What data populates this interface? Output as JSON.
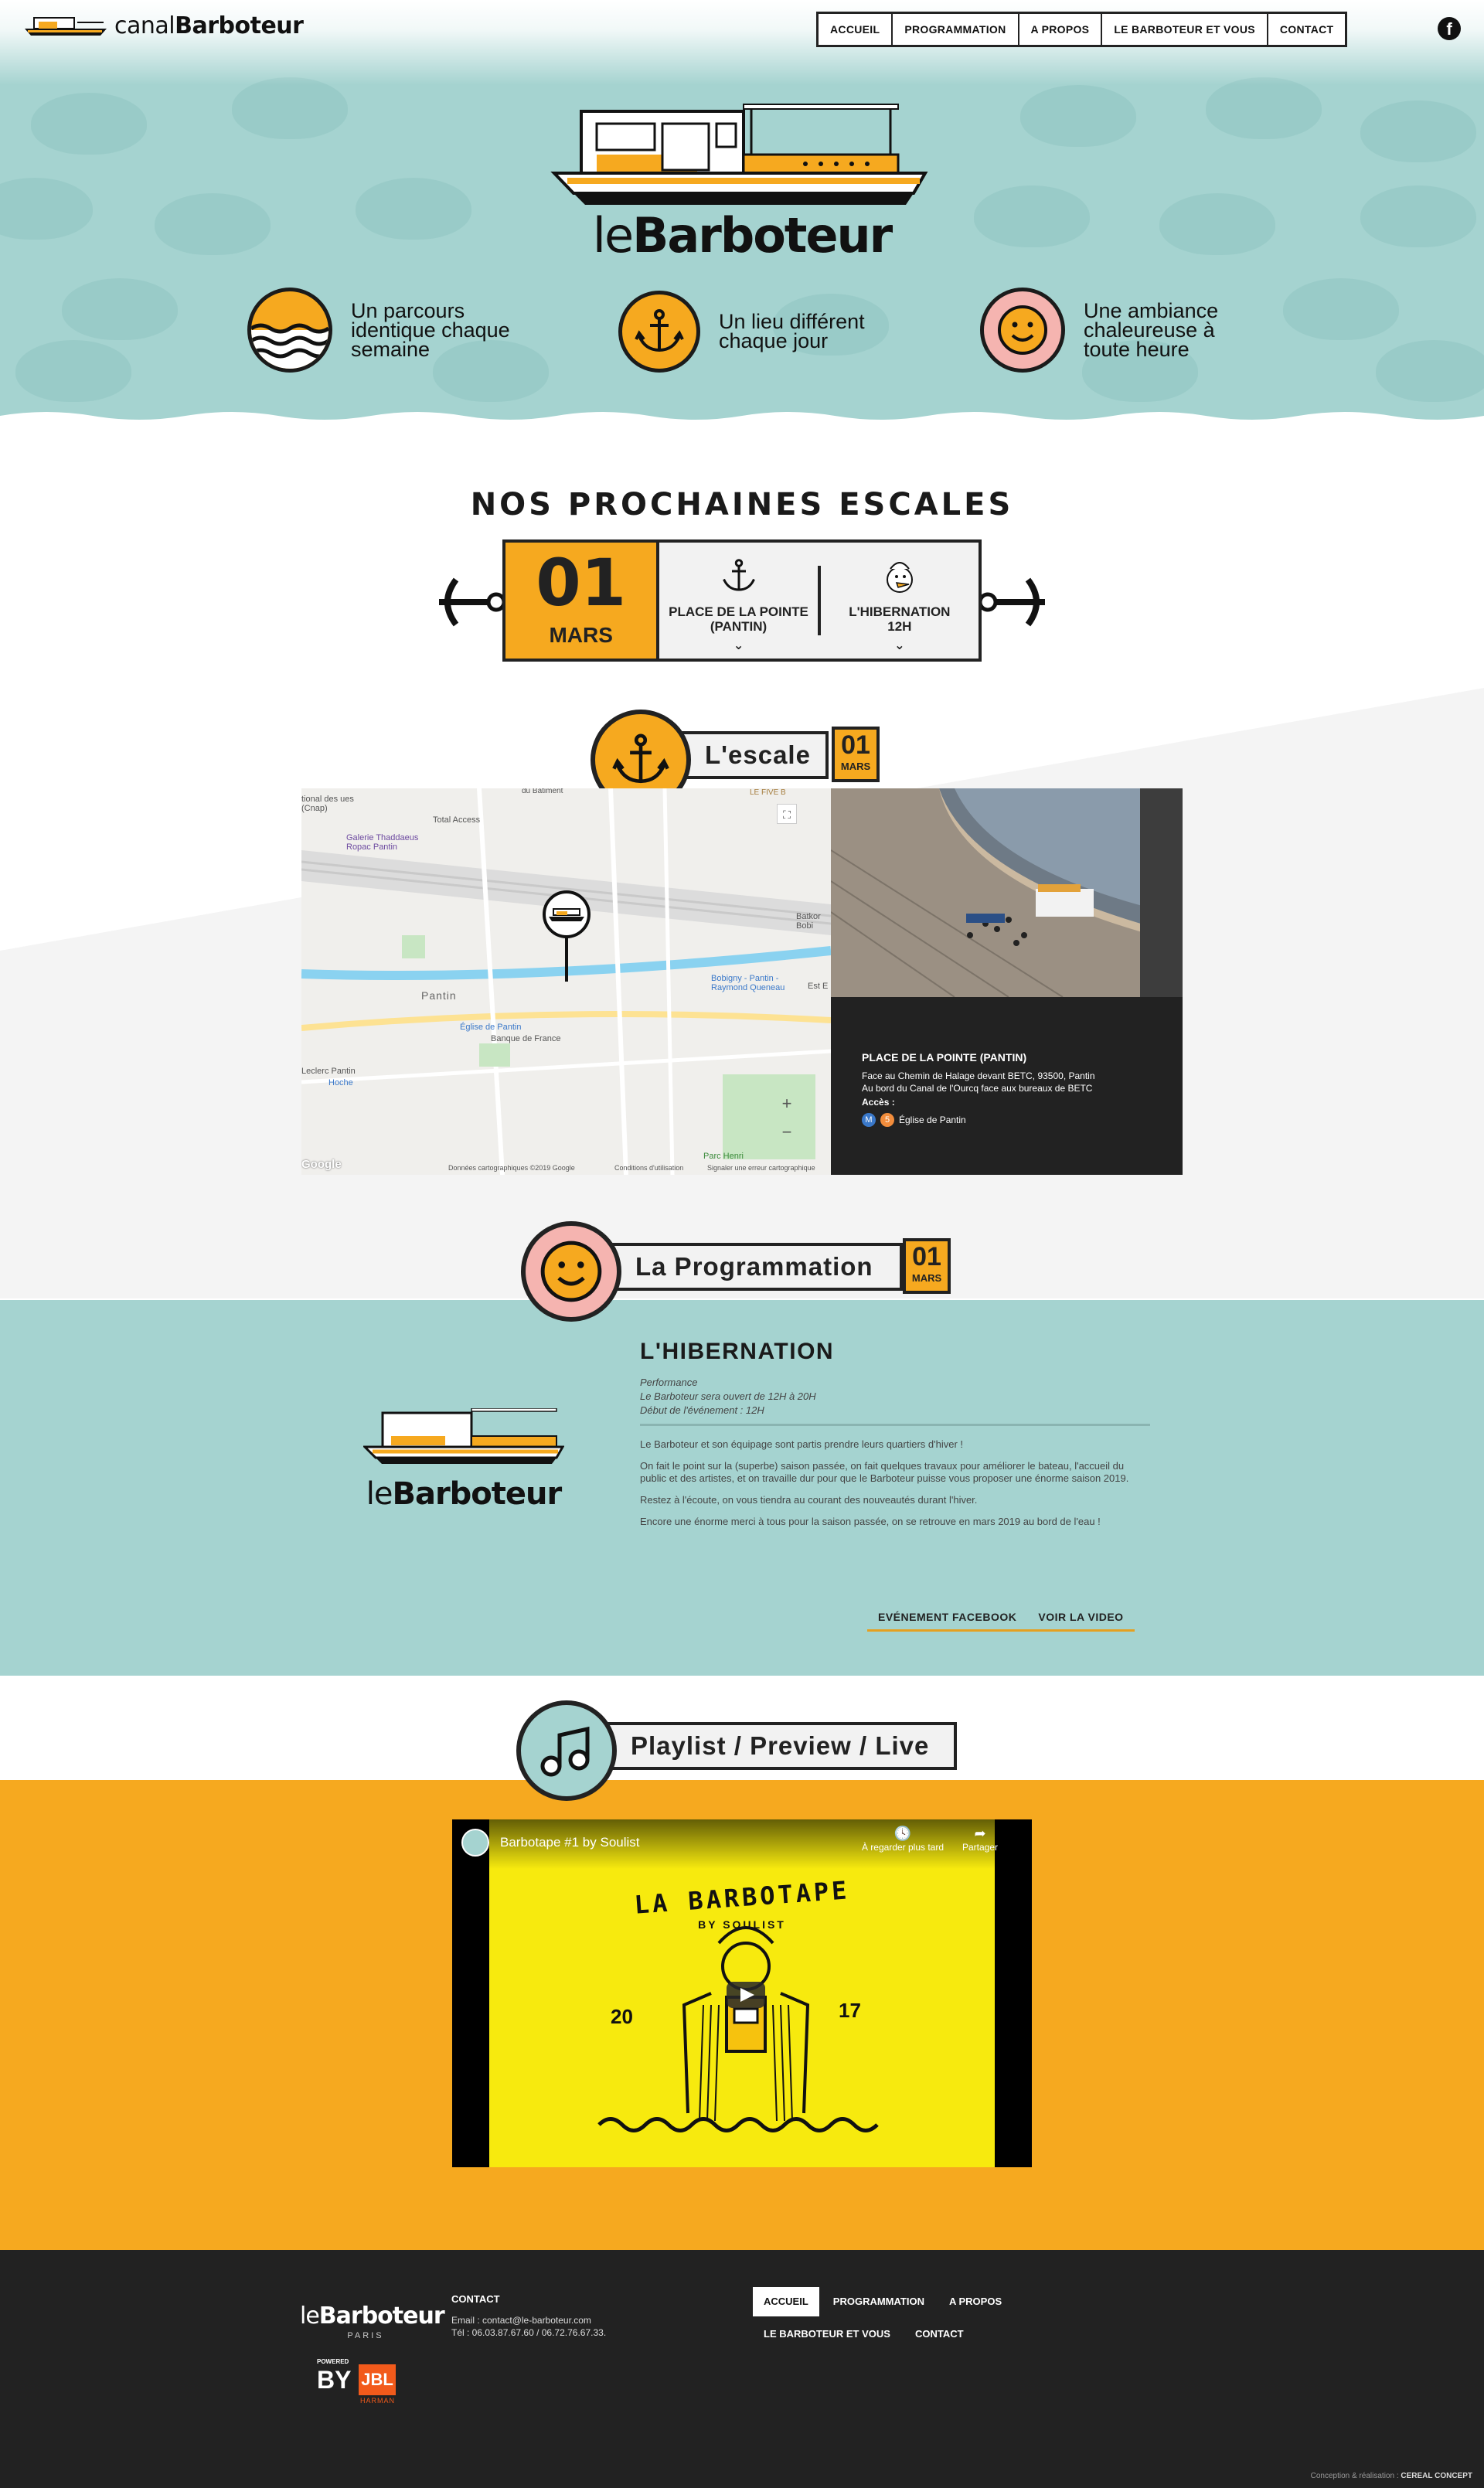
{
  "header": {
    "brand_prefix": "canal",
    "brand_name": "Barboteur",
    "nav": [
      "ACCUEIL",
      "PROGRAMMATION",
      "A PROPOS",
      "LE BARBOTEUR ET VOUS",
      "CONTACT"
    ],
    "social_icon": "facebook-icon"
  },
  "hero": {
    "logo_prefix": "le",
    "logo_name": "Barboteur",
    "features": [
      {
        "icon": "waves-icon",
        "text": "Un parcours identique chaque semaine"
      },
      {
        "icon": "anchor-icon",
        "text": "Un lieu différent chaque jour"
      },
      {
        "icon": "smiley-icon",
        "text": "Une ambiance chaleureuse à toute heure"
      }
    ]
  },
  "escales": {
    "title": "NOS PROCHAINES ESCALES",
    "day": "01",
    "month": "MARS",
    "place": "PLACE DE LA POINTE (PANTIN)",
    "event": "L'HIBERNATION",
    "time": "12H"
  },
  "escale_section": {
    "label": "L'escale",
    "day": "01",
    "month": "MARS",
    "map_labels": [
      "Pantin",
      "Église de Pantin",
      "Banque de France",
      "Galerie Thaddaeus Ropac Pantin",
      "Total Access",
      "Bobigny - Pantin - Raymond Queneau",
      "Hoche",
      "Leclerc Pantin",
      "Parc Henri",
      "Batkor Bobi",
      "Est E",
      "tional des ues (Cnap)",
      "LE FIVE B",
      "du Bâtiment",
      "Google",
      "Données cartographiques ©2019 Google",
      "Conditions d'utilisation",
      "Signaler une erreur cartographique"
    ],
    "info_title": "PLACE DE LA POINTE (PANTIN)",
    "info_lines": [
      "Face au Chemin de Halage devant BETC, 93500, Pantin",
      "Au bord du Canal de l'Ourcq face aux bureaux de BETC"
    ],
    "access_label": "Accès :",
    "access_station": "Église de Pantin"
  },
  "programmation": {
    "label": "La Programmation",
    "day": "01",
    "month": "MARS",
    "logo_prefix": "le",
    "logo_name": "Barboteur",
    "title": "L'HIBERNATION",
    "type": "Performance",
    "hours": "Le Barboteur sera ouvert de 12H à 20H",
    "start": "Début de l'événement : 12H",
    "paragraphs": [
      "Le Barboteur et son équipage sont partis prendre leurs quartiers d'hiver !",
      "On fait le point sur la (superbe) saison passée, on fait quelques travaux pour améliorer le bateau, l'accueil du public et des artistes, et on travaille dur pour que le Barboteur puisse vous proposer une énorme saison 2019.",
      "Restez à l'écoute, on vous tiendra au courant des nouveautés durant l'hiver.",
      "Encore une énorme merci à tous pour la saison passée, on se retrouve en mars 2019 au bord de l'eau !"
    ],
    "links": [
      "EVÉNEMENT FACEBOOK",
      "VOIR LA VIDEO"
    ]
  },
  "playlist": {
    "label": "Playlist / Preview / Live",
    "video_title": "Barbotape #1 by Soulist",
    "watch_later": "À regarder plus tard",
    "share": "Partager",
    "art_title": "LA BARBOTAPE",
    "art_sub": "BY SOULIST",
    "art_year_left": "20",
    "art_year_right": "17"
  },
  "footer": {
    "logo_prefix": "le",
    "logo_name": "Barboteur",
    "logo_city": "PARIS",
    "powered": "POWERED",
    "by": "BY",
    "jbl": "JBL",
    "harman": "HARMAN",
    "contact_title": "CONTACT",
    "email": "Email : contact@le-barboteur.com",
    "phone": "Tél : 06.03.87.67.60 / 06.72.76.67.33.",
    "nav_row1": [
      "ACCUEIL",
      "PROGRAMMATION",
      "A PROPOS"
    ],
    "nav_row2": [
      "LE BARBOTEUR ET VOUS",
      "CONTACT"
    ],
    "credit_label": "Conception & réalisation :",
    "credit_name": "CEREAL CONCEPT"
  },
  "colors": {
    "teal": "#a5d3d0",
    "orange": "#f6a91f",
    "pink": "#f5b4b0",
    "dark": "#222222"
  }
}
